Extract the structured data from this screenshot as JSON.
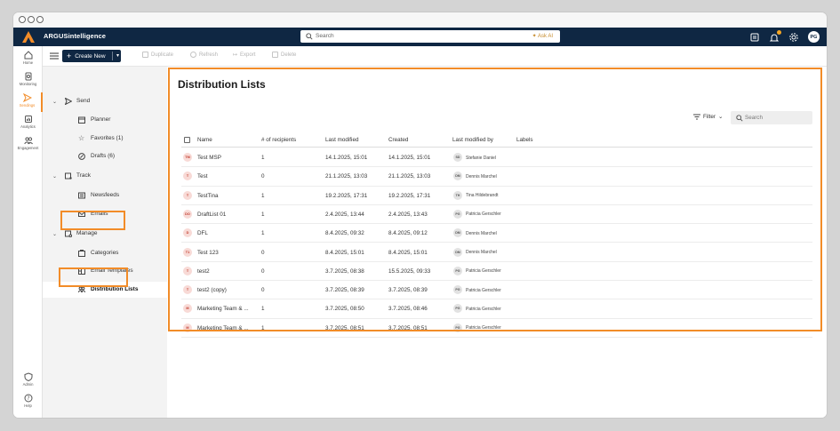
{
  "app": {
    "brand": "ARGUSintelligence"
  },
  "search": {
    "placeholder": "Search",
    "ask_ai": "Ask AI"
  },
  "user": {
    "initials": "PG"
  },
  "colors": {
    "accent": "#f28c28",
    "navy": "#0f2743"
  },
  "rail": [
    {
      "label": "Home",
      "icon": "home-icon"
    },
    {
      "label": "Monitoring",
      "icon": "monitoring-icon"
    },
    {
      "label": "Sendings",
      "icon": "send-icon",
      "active": true
    },
    {
      "label": "Analytics",
      "icon": "analytics-icon"
    },
    {
      "label": "Engagement",
      "icon": "engagement-icon"
    },
    {
      "label": "Admin",
      "icon": "shield-icon"
    },
    {
      "label": "Help",
      "icon": "help-icon"
    }
  ],
  "toolbar": {
    "create_label": "Create New",
    "duplicate_label": "Duplicate",
    "refresh_label": "Refresh",
    "export_label": "Export",
    "delete_label": "Delete"
  },
  "nav": {
    "send": "Send",
    "planner": "Planner",
    "favorites": "Favorites (1)",
    "drafts": "Drafts (6)",
    "track": "Track",
    "newsfeeds": "Newsfeeds",
    "emails": "Emails",
    "manage": "Manage",
    "categories": "Categories",
    "email_templates": "Email Templates",
    "distribution_lists": "Distribution Lists"
  },
  "main": {
    "title": "Distribution Lists",
    "filter_label": "Filter",
    "search_placeholder": "Search",
    "columns": [
      "Name",
      "# of recipients",
      "Last modified",
      "Created",
      "Last modified by",
      "Labels"
    ],
    "rows": [
      {
        "initials": "TM",
        "name": "Test MSP",
        "recipients": "1",
        "modified": "14.1.2025, 15:01",
        "created": "14.1.2025, 15:01",
        "by_initials": "SD",
        "by": "Stefanie Daniel"
      },
      {
        "initials": "T",
        "name": "Test",
        "recipients": "0",
        "modified": "21.1.2025, 13:03",
        "created": "21.1.2025, 13:03",
        "by_initials": "DM",
        "by": "Dennis Marchel"
      },
      {
        "initials": "T",
        "name": "TestTina",
        "recipients": "1",
        "modified": "19.2.2025, 17:31",
        "created": "19.2.2025, 17:31",
        "by_initials": "TH",
        "by": "Tina Hildebrandt"
      },
      {
        "initials": "DO",
        "name": "DraftList 01",
        "recipients": "1",
        "modified": "2.4.2025, 13:44",
        "created": "2.4.2025, 13:43",
        "by_initials": "PG",
        "by": "Patricia Gerschler"
      },
      {
        "initials": "D",
        "name": "DFL",
        "recipients": "1",
        "modified": "8.4.2025, 09:32",
        "created": "8.4.2025, 09:12",
        "by_initials": "DM",
        "by": "Dennis Marchel"
      },
      {
        "initials": "T1",
        "name": "Test 123",
        "recipients": "0",
        "modified": "8.4.2025, 15:01",
        "created": "8.4.2025, 15:01",
        "by_initials": "DM",
        "by": "Dennis Marchel"
      },
      {
        "initials": "T",
        "name": "test2",
        "recipients": "0",
        "modified": "3.7.2025, 08:38",
        "created": "15.5.2025, 09:33",
        "by_initials": "PG",
        "by": "Patricia Gerschler"
      },
      {
        "initials": "T",
        "name": "test2 (copy)",
        "recipients": "0",
        "modified": "3.7.2025, 08:39",
        "created": "3.7.2025, 08:39",
        "by_initials": "PG",
        "by": "Patricia Gerschler"
      },
      {
        "initials": "M",
        "name": "Marketing Team & ...",
        "recipients": "1",
        "modified": "3.7.2025, 08:50",
        "created": "3.7.2025, 08:46",
        "by_initials": "PG",
        "by": "Patricia Gerschler"
      },
      {
        "initials": "M",
        "name": "Marketing Team & ...",
        "recipients": "1",
        "modified": "3.7.2025, 08:51",
        "created": "3.7.2025, 08:51",
        "by_initials": "PG",
        "by": "Patricia Gerschler"
      }
    ]
  }
}
